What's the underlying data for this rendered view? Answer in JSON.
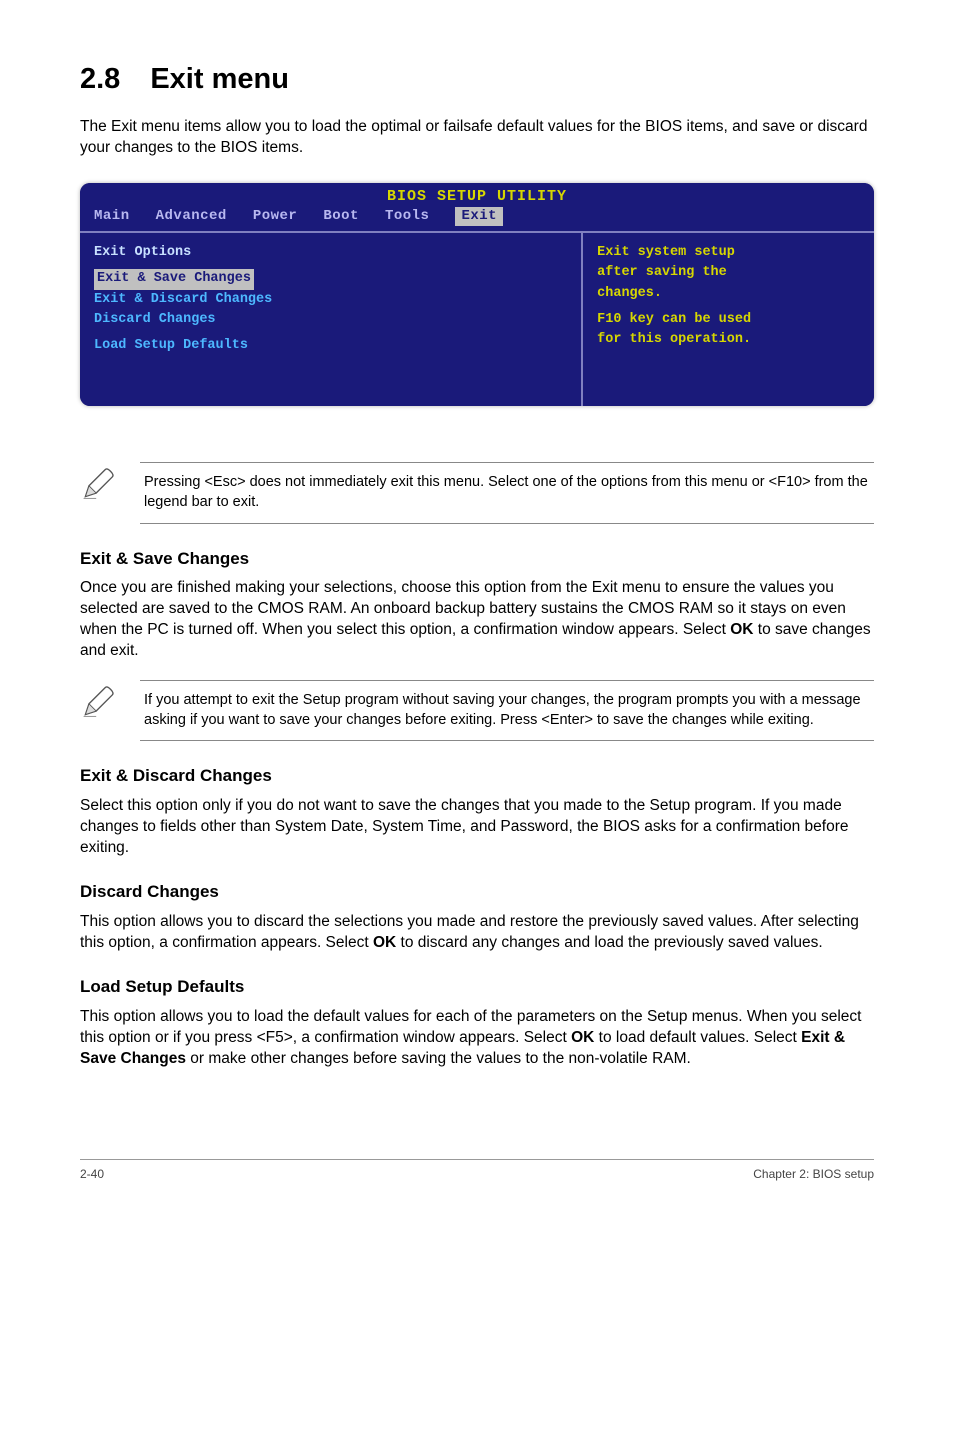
{
  "heading": {
    "num": "2.8",
    "title": "Exit menu"
  },
  "intro": "The Exit menu items allow you to load the optimal or failsafe default values for the BIOS items, and save or discard your changes to the BIOS items.",
  "bios": {
    "title": "BIOS SETUP UTILITY",
    "tabs": {
      "main": "Main",
      "advanced": "Advanced",
      "power": "Power",
      "boot": "Boot",
      "tools": "Tools",
      "exit": "Exit"
    },
    "left": {
      "heading": "Exit Options",
      "item1": "Exit & Save Changes",
      "item2": "Exit & Discard Changes",
      "item3": "Discard Changes",
      "item4": "Load Setup Defaults"
    },
    "right": {
      "line1": "Exit system setup",
      "line2": "after saving the",
      "line3": "changes.",
      "line4": "F10 key can be used",
      "line5": "for this operation."
    }
  },
  "note1": "Pressing <Esc> does not immediately exit this menu. Select one of the options from this menu or <F10> from the legend bar to exit.",
  "s1": {
    "head": "Exit & Save Changes",
    "p1a": "Once you are finished making your selections, choose this option from the Exit menu to ensure the values you selected are saved to the CMOS RAM. An onboard backup battery sustains the CMOS RAM so it stays on even when the PC is turned off. When you select this option, a confirmation window appears. Select ",
    "p1ok": "OK",
    "p1b": " to save changes and exit."
  },
  "note2": " If you attempt to exit the Setup program without saving your changes, the program prompts you with a message asking if you want to save your changes before exiting. Press <Enter>  to save the  changes while exiting.",
  "s2": {
    "head": "Exit & Discard Changes",
    "p": "Select this option only if you do not want to save the changes that you  made to the Setup program. If you made changes to fields other than System Date, System Time, and Password, the BIOS asks for a confirmation before exiting."
  },
  "s3": {
    "head": "Discard Changes",
    "p1": "This option allows you to discard the selections you made and restore the previously saved values. After selecting this option, a confirmation appears. Select ",
    "p1ok": "OK",
    "p1b": " to discard any changes and load the previously saved values."
  },
  "s4": {
    "head": "Load Setup Defaults",
    "p1": "This option allows you to load the default values for each of the parameters on the Setup menus. When you select this option or if you press <F5>, a confirmation window appears. Select ",
    "p1ok": "OK",
    "p1b": " to load default values. Select ",
    "p1ex": "Exit & Save Changes",
    "p1c": " or make other changes before saving the values to the non-volatile RAM."
  },
  "footer": {
    "left": "2-40",
    "right": "Chapter 2: BIOS setup"
  }
}
